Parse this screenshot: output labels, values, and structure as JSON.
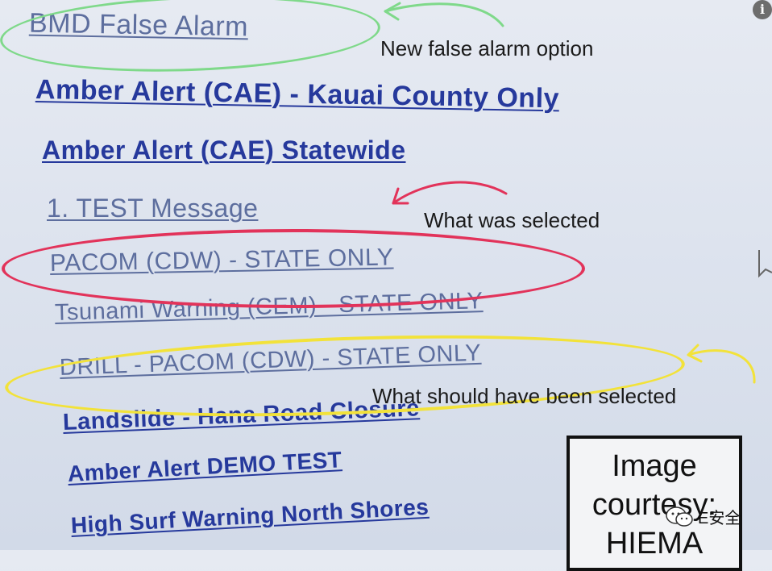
{
  "menu": {
    "items": [
      {
        "label": "BMD False Alarm"
      },
      {
        "label": "Amber Alert (CAE) - Kauai County Only"
      },
      {
        "label": "Amber Alert (CAE) Statewide"
      },
      {
        "label": "1. TEST Message"
      },
      {
        "label": "PACOM (CDW) - STATE ONLY"
      },
      {
        "label": "Tsunami Warning (CEM) - STATE ONLY"
      },
      {
        "label": "DRILL - PACOM (CDW) - STATE ONLY"
      },
      {
        "label": "Landslide - Hana Road Closure"
      },
      {
        "label": "Amber Alert DEMO TEST"
      },
      {
        "label": "High Surf Warning North Shores"
      }
    ]
  },
  "annotations": {
    "new_option": "New false alarm option",
    "selected": "What was selected",
    "should_have": "What should have been selected",
    "colors": {
      "green": "#7fd98a",
      "red": "#e2335a",
      "yellow": "#f2e23a"
    }
  },
  "courtesy": {
    "lines": [
      "Image",
      "courtesy:",
      "HIEMA"
    ]
  },
  "watermark": {
    "text": "E安全"
  }
}
